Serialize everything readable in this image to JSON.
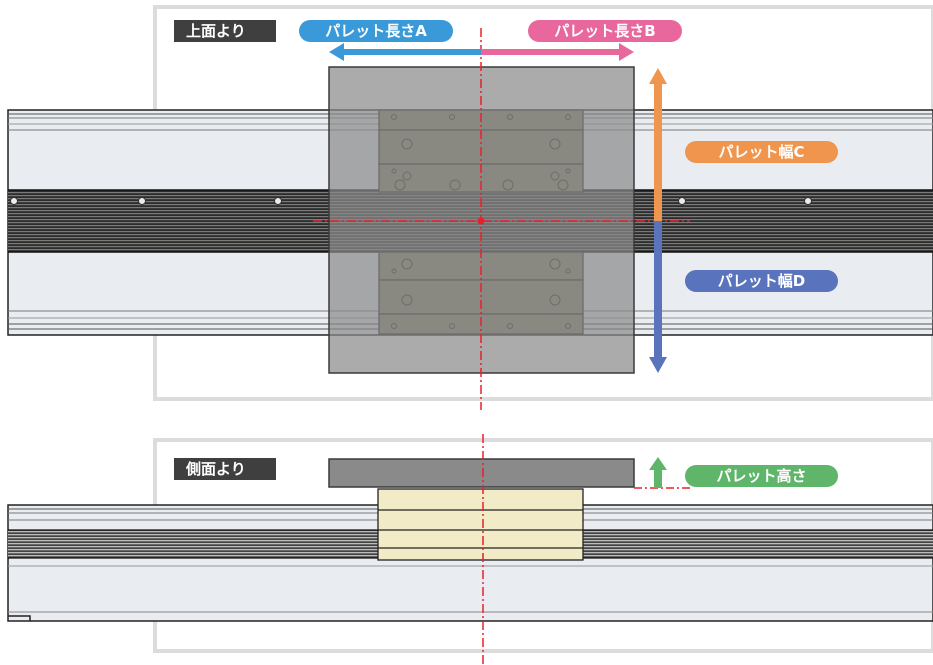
{
  "top_view": {
    "label": "上面より",
    "pallet_length_a": "パレット長さA",
    "pallet_length_b": "パレット長さB",
    "pallet_width_c": "パレット幅C",
    "pallet_width_d": "パレット幅D"
  },
  "side_view": {
    "label": "側面より",
    "pallet_height": "パレット高さ"
  },
  "colors": {
    "length_a": "#3a9ad9",
    "length_b": "#e8689d",
    "width_c": "#f0954d",
    "width_d": "#5a73bd",
    "height": "#5fb56a",
    "center_line": "#e8202a",
    "pallet_gray": "#8a8a8a",
    "slider_olive": "#868069",
    "slider_cream": "#f1ebc8",
    "rail_light": "#e9ecf0",
    "rail_dark": "#3a3a3a",
    "frame": "#dcdcdc"
  }
}
